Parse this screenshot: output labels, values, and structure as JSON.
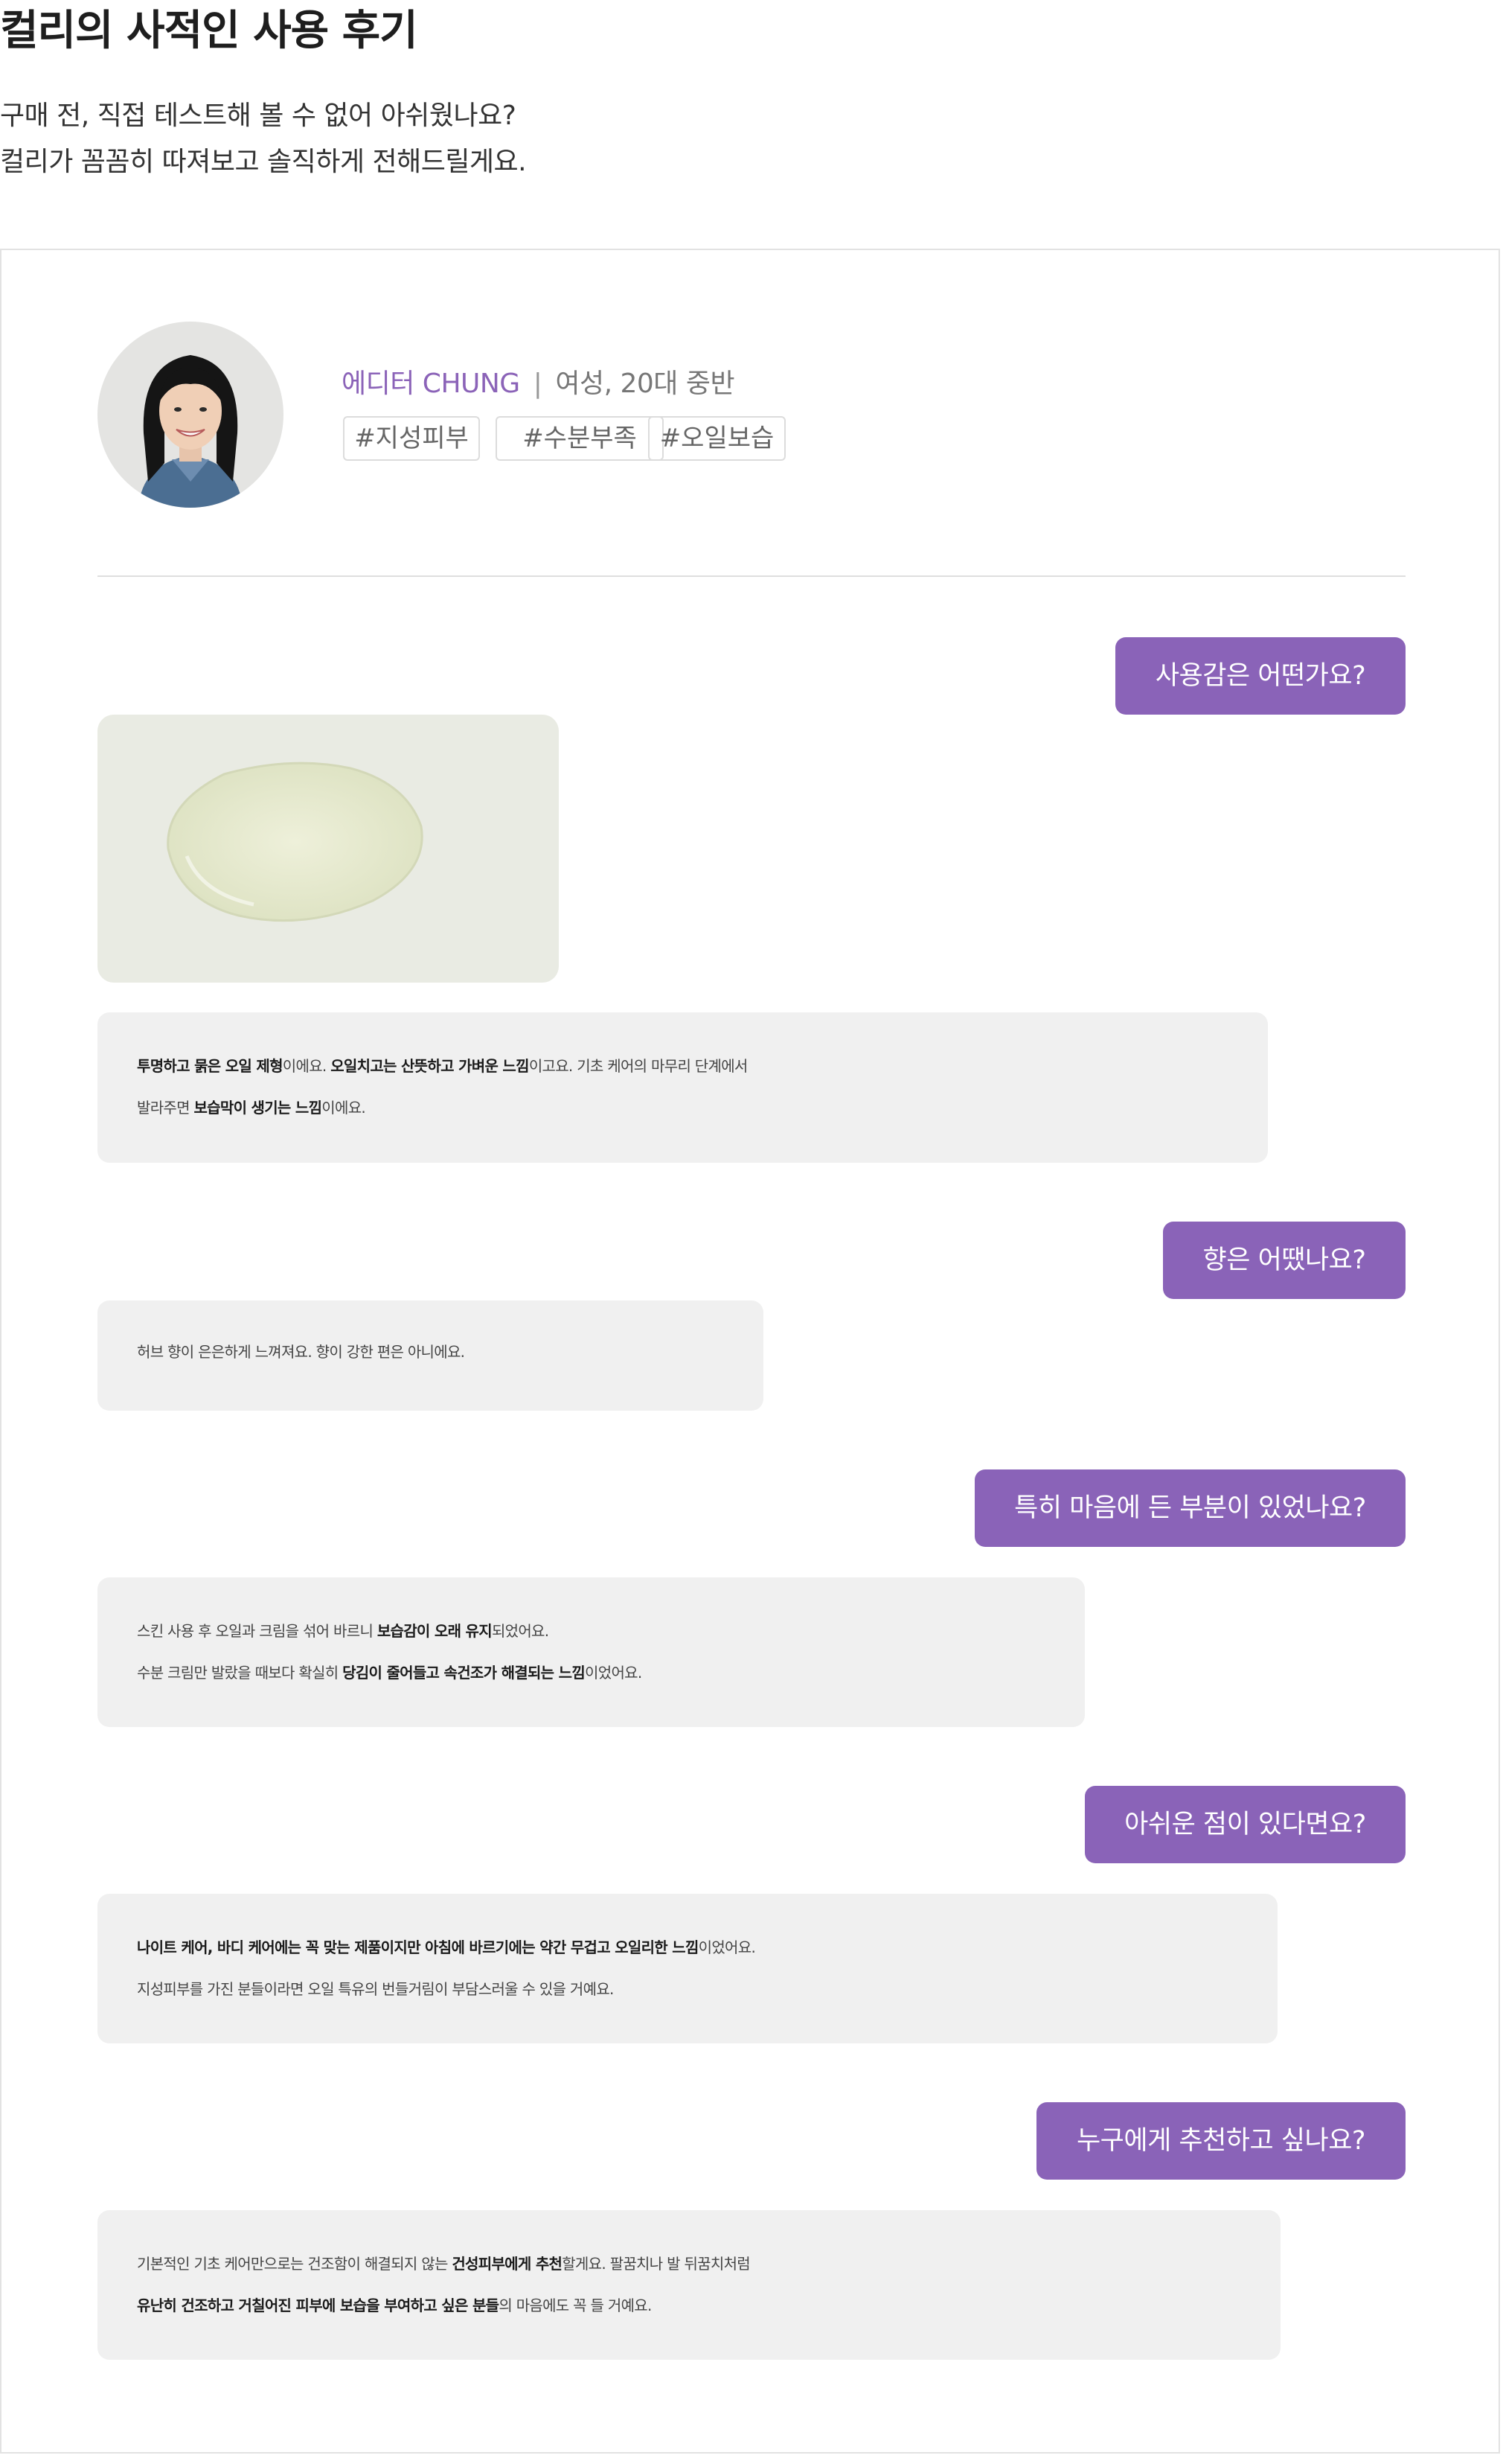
{
  "header": {
    "title": "컬리의 사적인 사용 후기",
    "intro_line1": "구매 전, 직접 테스트해 볼 수 없어 아쉬웠나요?",
    "intro_line2": "컬리가 꼼꼼히 따져보고 솔직하게 전해드릴게요."
  },
  "editor": {
    "label": "에디터 CHUNG",
    "separator": "|",
    "profile": "여성, 20대 중반",
    "tags": [
      "#지성피부",
      "#수분부족",
      "#오일보습"
    ]
  },
  "qa": [
    {
      "question": "사용감은 어떤가요?",
      "answer_lines": [
        [
          {
            "t": "투명하고 묽은 오일 제형",
            "b": true
          },
          {
            "t": "이에요. ",
            "b": false
          },
          {
            "t": "오일치고는 산뜻하고 가벼운 느낌",
            "b": true
          },
          {
            "t": "이고요. 기초 케어의 마무리 단계에서",
            "b": false
          }
        ],
        [
          {
            "t": "발라주면 ",
            "b": false
          },
          {
            "t": "보습막이 생기는 느낌",
            "b": true
          },
          {
            "t": "이에요.",
            "b": false
          }
        ]
      ]
    },
    {
      "question": "향은 어땠나요?",
      "answer_lines": [
        [
          {
            "t": "허브 향이 은은하게 느껴져요. 향이 강한 편은 아니에요.",
            "b": false
          }
        ]
      ]
    },
    {
      "question": "특히 마음에 든 부분이 있었나요?",
      "answer_lines": [
        [
          {
            "t": "스킨 사용 후 오일과 크림을 섞어 바르니 ",
            "b": false
          },
          {
            "t": "보습감이 오래 유지",
            "b": true
          },
          {
            "t": "되었어요.",
            "b": false
          }
        ],
        [
          {
            "t": "수분 크림만 발랐을 때보다 확실히 ",
            "b": false
          },
          {
            "t": "당김이 줄어들고 속건조가 해결되는 느낌",
            "b": true
          },
          {
            "t": "이었어요.",
            "b": false
          }
        ]
      ]
    },
    {
      "question": "아쉬운 점이 있다면요?",
      "answer_lines": [
        [
          {
            "t": "나이트 케어, 바디 케어에는 꼭 맞는 제품이지만 아침에 바르기에는 약간 무겁고 오일리한 느낌",
            "b": true
          },
          {
            "t": "이었어요.",
            "b": false
          }
        ],
        [
          {
            "t": "지성피부를 가진 분들이라면 오일 특유의 번들거림이 부담스러울 수 있을 거예요.",
            "b": false
          }
        ]
      ]
    },
    {
      "question": "누구에게 추천하고 싶나요?",
      "answer_lines": [
        [
          {
            "t": "기본적인 기초 케어만으로는 건조함이 해결되지 않는 ",
            "b": false
          },
          {
            "t": "건성피부에게 추천",
            "b": true
          },
          {
            "t": "할게요. 팔꿈치나 발 뒤꿈치처럼",
            "b": false
          }
        ],
        [
          {
            "t": "유난히 건조하고 거칠어진 피부에 보습을 부여하고 싶은 분들",
            "b": true
          },
          {
            "t": "의 마음에도 꼭 들 거예요.",
            "b": false
          }
        ]
      ]
    }
  ],
  "colors": {
    "accent": "#8a63b8",
    "answer_bg": "#f0f0f0",
    "border": "#e2e2e2"
  },
  "images": {
    "avatar": "editor-portrait",
    "product": "oil-texture-swatch"
  }
}
